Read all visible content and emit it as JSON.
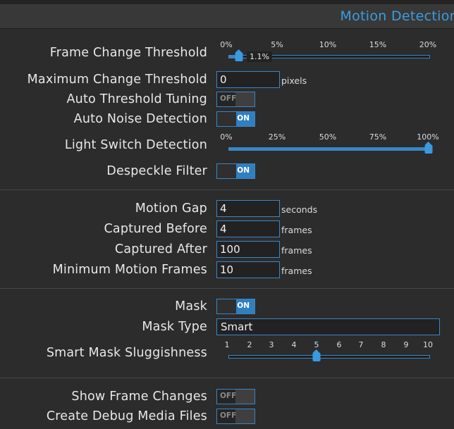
{
  "header": {
    "title": "Motion Detection"
  },
  "general": {
    "frame_change_threshold": {
      "label": "Frame Change Threshold",
      "ticks": [
        "0%",
        "5%",
        "10%",
        "15%",
        "20%"
      ],
      "value": "1.1%"
    },
    "max_change_threshold": {
      "label": "Maximum Change Threshold",
      "value": "0",
      "unit": "pixels"
    },
    "auto_threshold_tuning": {
      "label": "Auto Threshold Tuning",
      "state": "OFF"
    },
    "auto_noise_detection": {
      "label": "Auto Noise Detection",
      "state": "ON"
    },
    "light_switch_detection": {
      "label": "Light Switch Detection",
      "ticks": [
        "0%",
        "25%",
        "50%",
        "75%",
        "100%"
      ],
      "value_percent": 100
    },
    "despeckle_filter": {
      "label": "Despeckle Filter",
      "state": "ON"
    }
  },
  "timing": {
    "motion_gap": {
      "label": "Motion Gap",
      "value": "4",
      "unit": "seconds"
    },
    "captured_before": {
      "label": "Captured Before",
      "value": "4",
      "unit": "frames"
    },
    "captured_after": {
      "label": "Captured After",
      "value": "100",
      "unit": "frames"
    },
    "minimum_motion_frames": {
      "label": "Minimum Motion Frames",
      "value": "10",
      "unit": "frames"
    }
  },
  "mask": {
    "mask": {
      "label": "Mask",
      "state": "ON"
    },
    "mask_type": {
      "label": "Mask Type",
      "value": "Smart"
    },
    "smart_mask_sluggishness": {
      "label": "Smart Mask Sluggishness",
      "ticks": [
        "1",
        "2",
        "3",
        "4",
        "5",
        "6",
        "7",
        "8",
        "9",
        "10"
      ],
      "value": 5
    }
  },
  "debug": {
    "show_frame_changes": {
      "label": "Show Frame Changes",
      "state": "OFF"
    },
    "create_debug_media_files": {
      "label": "Create Debug Media Files",
      "state": "OFF"
    }
  },
  "colors": {
    "accent": "#3a85c5",
    "title": "#3d9be0",
    "background": "#2c2c2c"
  }
}
